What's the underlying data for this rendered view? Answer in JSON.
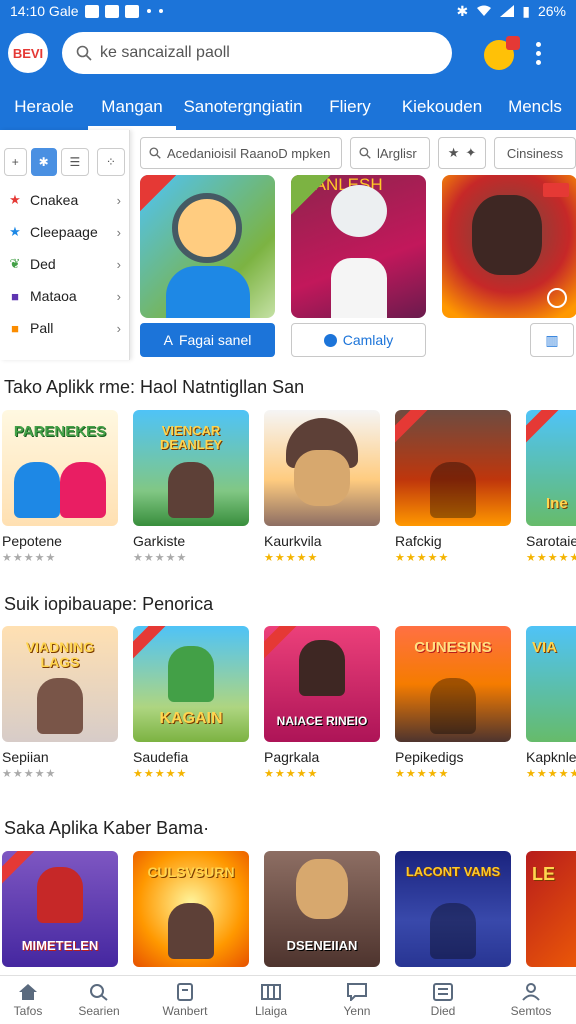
{
  "status_bar": {
    "time_carrier": "14:10 Gale",
    "battery": "26%"
  },
  "app_bar": {
    "logo_text": "BEVI",
    "search_placeholder": "ke sancaizall paoll"
  },
  "tabs": [
    {
      "label": "Heraole",
      "active": false
    },
    {
      "label": "Mangan",
      "active": true
    },
    {
      "label": "Sanotergngiatin",
      "active": false
    },
    {
      "label": "Fliery",
      "active": false
    },
    {
      "label": "Kiekouden",
      "active": false
    },
    {
      "label": "Mencls",
      "active": false
    }
  ],
  "sidebar": {
    "items": [
      {
        "label": "Cnakea",
        "icon": "star-icon",
        "color": "#e53935"
      },
      {
        "label": "Cleepaage",
        "icon": "star-icon",
        "color": "#1e88e5"
      },
      {
        "label": "Ded",
        "icon": "leaf-icon",
        "color": "#43a047"
      },
      {
        "label": "Mataoa",
        "icon": "app-icon",
        "color": "#5e35b1"
      },
      {
        "label": "Pall",
        "icon": "app-icon",
        "color": "#fb8c00"
      }
    ]
  },
  "filters": {
    "search_chip": "Acedanioisil RaanoD mpken",
    "chip2": "lArglisr",
    "chip4": "Cinsiness"
  },
  "featured": {
    "button1": "Fagai sanel",
    "button2": "Camlaly"
  },
  "tile_captions": {
    "featured_2": "DEANLESH",
    "row1_1": "PARENEKES",
    "row1_2": "VIENCAR DEANLEY",
    "row1_5": "Ine",
    "row2_1": "VIADNING LAGS",
    "row2_2": "KAGAIN",
    "row2_3": "NAIACE RINEIO",
    "row2_4": "CUNESINS",
    "row2_5": "VIA",
    "row3_1": "MIMETELEN",
    "row3_2": "CULSVSURN",
    "row3_3": "DSENEIIAN",
    "row3_4": "LACONT VAMS",
    "row3_5": "LE"
  },
  "sections": [
    {
      "title": "Tako Aplikk rme: Haol Natntigllan San",
      "apps": [
        {
          "name": "Pepotene",
          "rated": false
        },
        {
          "name": "Garkiste",
          "rated": false
        },
        {
          "name": "Kaurkvila",
          "rated": true
        },
        {
          "name": "Rafckig",
          "rated": true
        },
        {
          "name": "Sarotaie",
          "rated": true
        }
      ]
    },
    {
      "title": "Suik iopibauape: Penorica",
      "apps": [
        {
          "name": "Sepiian",
          "rated": false
        },
        {
          "name": "Saudefia",
          "rated": true
        },
        {
          "name": "Pagrkala",
          "rated": true
        },
        {
          "name": "Pepikedigs",
          "rated": true
        },
        {
          "name": "Kapknle",
          "rated": true
        }
      ]
    },
    {
      "title": "Saka Aplika Kaber Bama·"
    }
  ],
  "bottom_nav": [
    {
      "label": "Tafos",
      "icon": "home-icon"
    },
    {
      "label": "Searien",
      "icon": "search-icon"
    },
    {
      "label": "Wanbert",
      "icon": "document-icon"
    },
    {
      "label": "Llaiga",
      "icon": "library-icon"
    },
    {
      "label": "Yenn",
      "icon": "chat-icon"
    },
    {
      "label": "Died",
      "icon": "list-icon"
    },
    {
      "label": "Semtos",
      "icon": "person-icon"
    }
  ],
  "colors": {
    "primary": "#1c74d9",
    "accent_red": "#e53935",
    "star": "#f4b400"
  }
}
